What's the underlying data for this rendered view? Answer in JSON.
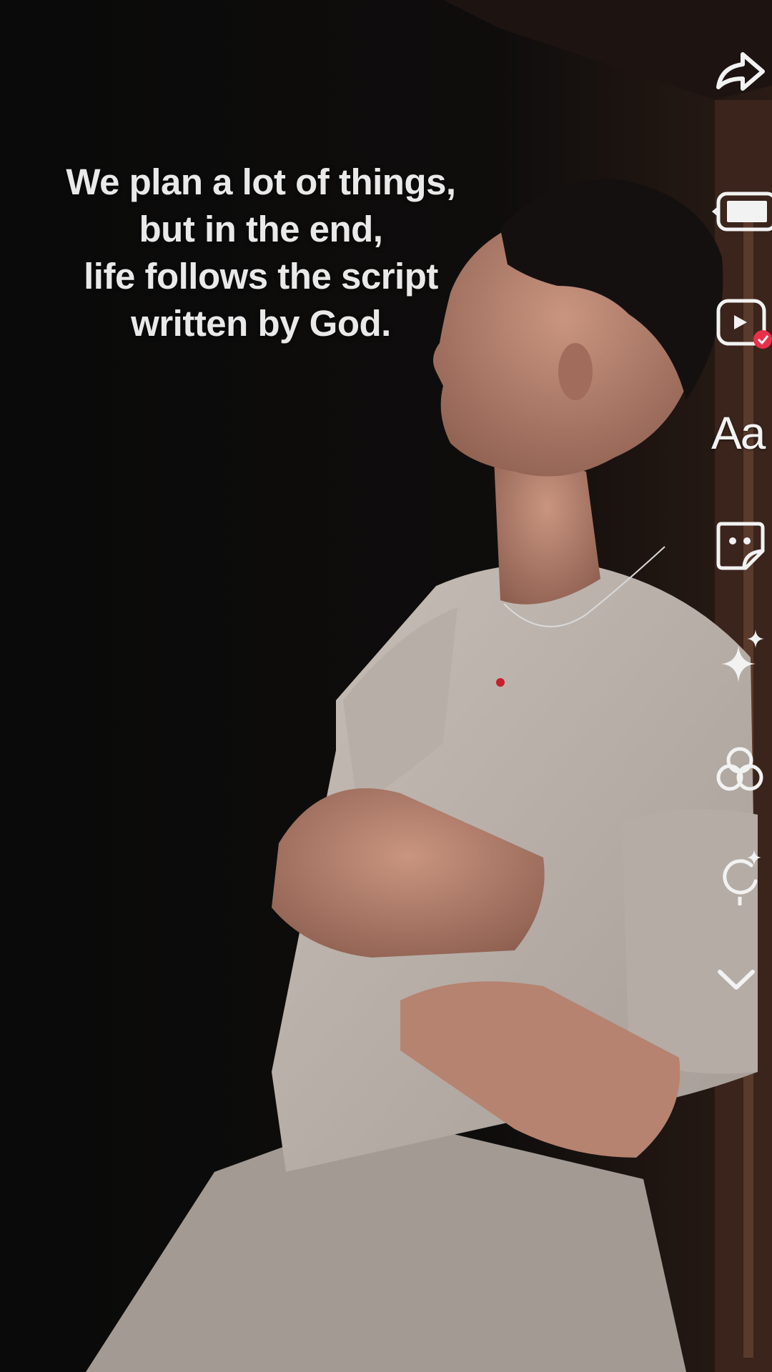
{
  "caption": {
    "lines": [
      "We plan a lot of things,",
      "but in the end,",
      "life follows the script",
      "written by God."
    ]
  },
  "toolbar": {
    "items": [
      {
        "icon": "share-icon"
      },
      {
        "icon": "aspect-ratio-icon"
      },
      {
        "icon": "template-icon",
        "badge_color": "#e8304a"
      },
      {
        "icon": "text-icon",
        "label": "Aa"
      },
      {
        "icon": "sticker-icon"
      },
      {
        "icon": "effects-sparkle-icon"
      },
      {
        "icon": "filters-icon"
      },
      {
        "icon": "voice-effect-icon"
      },
      {
        "icon": "chevron-down-icon"
      }
    ]
  },
  "colors": {
    "background": "#0b0b0b",
    "icon": "#f2f2f2",
    "badge": "#e8304a",
    "shirt": "#bdb4ad",
    "skin": "#b88470"
  }
}
